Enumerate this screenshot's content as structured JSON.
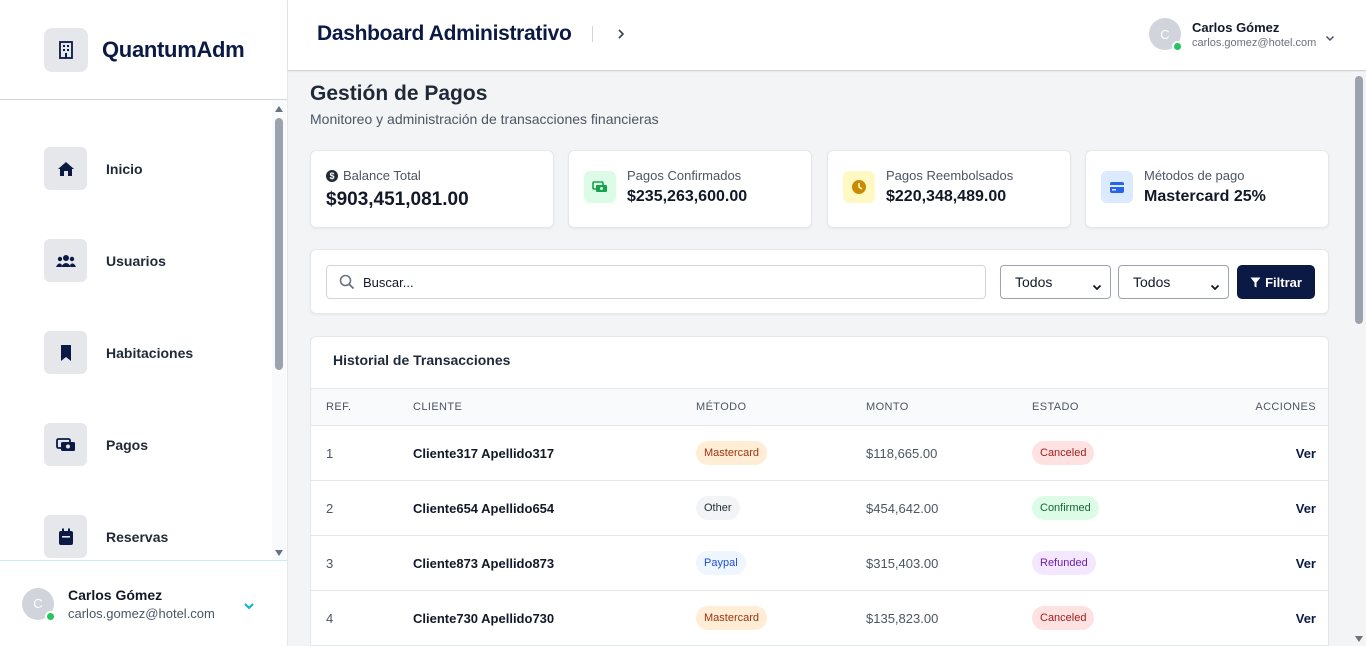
{
  "brand": {
    "name": "QuantumAdm"
  },
  "sidebar": {
    "items": [
      {
        "label": "Inicio",
        "icon": "home-icon"
      },
      {
        "label": "Usuarios",
        "icon": "users-icon"
      },
      {
        "label": "Habitaciones",
        "icon": "bookmark-icon"
      },
      {
        "label": "Pagos",
        "icon": "money-icon"
      },
      {
        "label": "Reservas",
        "icon": "calendar-icon"
      }
    ],
    "user": {
      "initial": "C",
      "name": "Carlos Gómez",
      "email": "carlos.gomez@hotel.com"
    }
  },
  "header": {
    "title": "Dashboard Administrativo",
    "user": {
      "initial": "C",
      "name": "Carlos Gómez",
      "email": "carlos.gomez@hotel.com"
    }
  },
  "page": {
    "title": "Gestión de Pagos",
    "subtitle": "Monitoreo y administración de transacciones financieras"
  },
  "stats": [
    {
      "label": "Balance Total",
      "value": "$903,451,081.00"
    },
    {
      "label": "Pagos Confirmados",
      "value": "$235,263,600.00",
      "color": "#16a34a",
      "bg": "#dcfce7"
    },
    {
      "label": "Pagos Reembolsados",
      "value": "$220,348,489.00",
      "color": "#ca8a04",
      "bg": "#fef9c3"
    },
    {
      "label": "Métodos de pago",
      "value": "Mastercard 25%",
      "color": "#2563eb",
      "bg": "#dbeafe"
    }
  ],
  "filters": {
    "search_placeholder": "Buscar...",
    "method_selected": "Todos",
    "status_selected": "Todos",
    "filter_label": "Filtrar"
  },
  "table": {
    "title": "Historial de Transacciones",
    "headers": {
      "ref": "REF.",
      "client": "CLIENTE",
      "method": "MÉTODO",
      "amount": "MONTO",
      "status": "ESTADO",
      "actions": "ACCIONES"
    },
    "rows": [
      {
        "ref": "1",
        "client": "Cliente317 Apellido317",
        "method": "Mastercard",
        "amount": "$118,665.00",
        "status": "Canceled",
        "action": "Ver"
      },
      {
        "ref": "2",
        "client": "Cliente654 Apellido654",
        "method": "Other",
        "amount": "$454,642.00",
        "status": "Confirmed",
        "action": "Ver"
      },
      {
        "ref": "3",
        "client": "Cliente873 Apellido873",
        "method": "Paypal",
        "amount": "$315,403.00",
        "status": "Refunded",
        "action": "Ver"
      },
      {
        "ref": "4",
        "client": "Cliente730 Apellido730",
        "method": "Mastercard",
        "amount": "$135,823.00",
        "status": "Canceled",
        "action": "Ver"
      }
    ]
  },
  "colors": {
    "primary": "#0b1a45",
    "online": "#22c55e",
    "pill_mastercard": "#ffedd5",
    "pill_other": "#f3f4f6",
    "pill_paypal": "#eff6ff",
    "pill_canceled": "#fee2e2",
    "pill_confirmed": "#dcfce7",
    "pill_refunded": "#f3e8ff"
  }
}
